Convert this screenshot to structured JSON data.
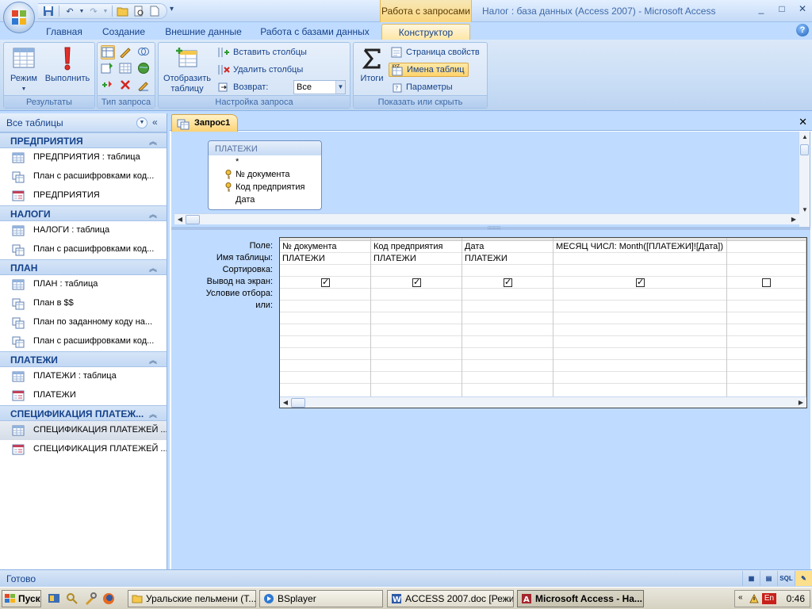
{
  "window": {
    "context_tab_group": "Работа с запросами",
    "title": "Налог : база данных (Access 2007) - Microsoft Access",
    "controls": [
      "minimize-icon",
      "maximize-icon",
      "close-icon"
    ]
  },
  "quick_access": {
    "items": [
      "save-icon",
      "undo-icon",
      "redo-icon",
      "open-icon",
      "print-preview-icon",
      "new-icon"
    ]
  },
  "ribbon_tabs": [
    {
      "label": "Главная"
    },
    {
      "label": "Создание"
    },
    {
      "label": "Внешние данные"
    },
    {
      "label": "Работа с базами данных"
    },
    {
      "label": "Конструктор",
      "active": true
    }
  ],
  "ribbon": {
    "results": {
      "label": "Результаты",
      "view": "Режим",
      "run": "Выполнить"
    },
    "query_type": {
      "label": "Тип запроса"
    },
    "query_setup": {
      "label": "Настройка запроса",
      "show_table": "Отобразить таблицу",
      "insert_columns": "Вставить столбцы",
      "delete_columns": "Удалить столбцы",
      "return_label": "Возврат:",
      "return_value": "Все"
    },
    "show_hide": {
      "label": "Показать или скрыть",
      "totals": "Итоги",
      "property_sheet": "Страница свойств",
      "table_names": "Имена таблиц",
      "parameters": "Параметры"
    }
  },
  "nav": {
    "title": "Все таблицы",
    "groups": [
      {
        "name": "ПРЕДПРИЯТИЯ",
        "items": [
          {
            "icon": "table",
            "label": "ПРЕДПРИЯТИЯ : таблица"
          },
          {
            "icon": "query",
            "label": "План с расшифровками код..."
          },
          {
            "icon": "form",
            "label": "ПРЕДПРИЯТИЯ"
          }
        ]
      },
      {
        "name": "НАЛОГИ",
        "items": [
          {
            "icon": "table",
            "label": "НАЛОГИ : таблица"
          },
          {
            "icon": "query",
            "label": "План с расшифровками код..."
          }
        ]
      },
      {
        "name": "ПЛАН",
        "items": [
          {
            "icon": "table",
            "label": "ПЛАН : таблица"
          },
          {
            "icon": "query",
            "label": "План в $$"
          },
          {
            "icon": "query",
            "label": "План по заданному коду на..."
          },
          {
            "icon": "query",
            "label": "План с расшифровками код..."
          }
        ]
      },
      {
        "name": "ПЛАТЕЖИ",
        "items": [
          {
            "icon": "table",
            "label": "ПЛАТЕЖИ : таблица"
          },
          {
            "icon": "form",
            "label": "ПЛАТЕЖИ"
          }
        ]
      },
      {
        "name": "СПЕЦИФИКАЦИЯ ПЛАТЕЖ...",
        "items": [
          {
            "icon": "table",
            "label": "СПЕЦИФИКАЦИЯ ПЛАТЕЖЕЙ ...",
            "selected": true
          },
          {
            "icon": "form",
            "label": "СПЕЦИФИКАЦИЯ ПЛАТЕЖЕЙ ..."
          }
        ]
      }
    ]
  },
  "document": {
    "tab_label": "Запрос1",
    "field_list": {
      "title": "ПЛАТЕЖИ",
      "fields": [
        {
          "name": "*",
          "key": false
        },
        {
          "name": "№ документа",
          "key": true
        },
        {
          "name": "Код предприятия",
          "key": true
        },
        {
          "name": "Дата",
          "key": false
        }
      ]
    },
    "row_labels": [
      "Поле:",
      "Имя таблицы:",
      "Сортировка:",
      "Вывод на экран:",
      "Условие отбора:",
      "или:"
    ],
    "columns": [
      {
        "field": "№ документа",
        "table": "ПЛАТЕЖИ",
        "show": true
      },
      {
        "field": "Код предприятия",
        "table": "ПЛАТЕЖИ",
        "show": true
      },
      {
        "field": "Дата",
        "table": "ПЛАТЕЖИ",
        "show": true
      },
      {
        "field": "МЕСЯЦ ЧИСЛ: Month([ПЛАТЕЖИ]![Дата])",
        "table": "",
        "show": true
      },
      {
        "field": "",
        "table": "",
        "show": false
      }
    ]
  },
  "status": {
    "text": "Готово",
    "view_buttons": [
      "datasheet-view",
      "pivot-view",
      "SQL",
      "design-view"
    ]
  },
  "taskbar": {
    "start": "Пуск",
    "tasks": [
      {
        "label": "Уральские пельмени (Т...",
        "active": false
      },
      {
        "label": "BSplayer",
        "active": false
      },
      {
        "label": "ACCESS 2007.doc [Режи...",
        "active": false
      },
      {
        "label": "Microsoft Access - На...",
        "active": true
      }
    ],
    "lang": "En",
    "clock": "0:46"
  }
}
